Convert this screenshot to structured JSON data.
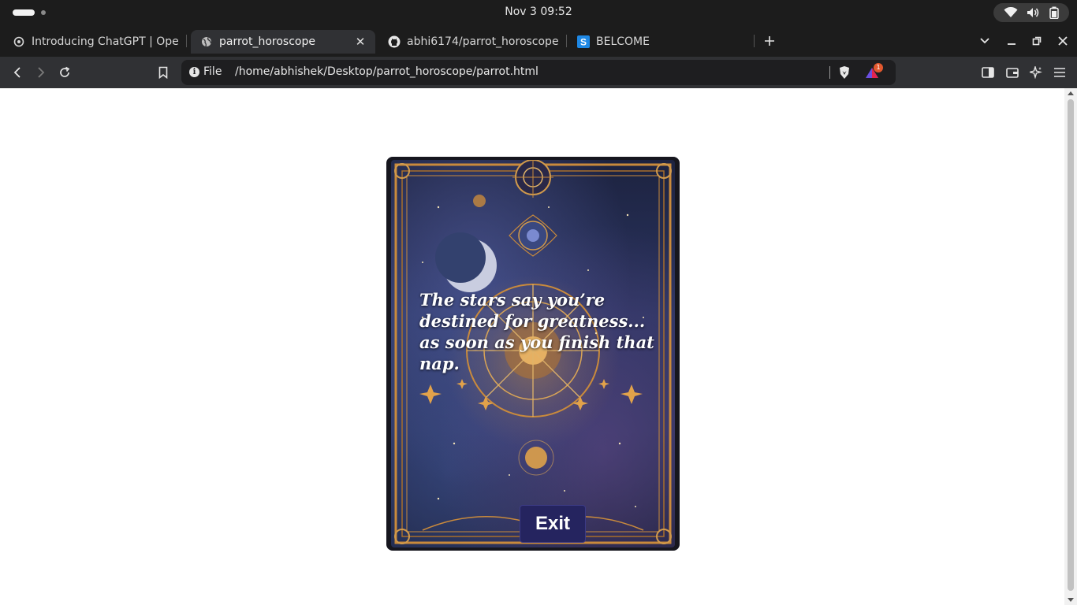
{
  "os": {
    "clock": "Nov 3  09:52",
    "status_icons": [
      "wifi-icon",
      "volume-icon",
      "battery-icon"
    ]
  },
  "tabs": [
    {
      "title": "Introducing ChatGPT | OpenAI",
      "icon": "openai-icon",
      "active": false
    },
    {
      "title": "parrot_horoscope",
      "icon": "globe-icon",
      "active": true
    },
    {
      "title": "abhi6174/parrot_horoscope",
      "icon": "github-icon",
      "active": false
    },
    {
      "title": "BELCOME‎",
      "icon": "s-app-icon",
      "active": false
    }
  ],
  "toolbar": {
    "scheme": "File",
    "url": "/home/abhishek/Desktop/parrot_horoscope/parrot.html",
    "rewards_badge": "1"
  },
  "page": {
    "fortune": "The stars say you’re destined for greatness... as soon as you finish that nap.",
    "exit_label": "Exit"
  },
  "colors": {
    "exit_button": "#25245f",
    "card_frame": "#c98a3c",
    "browser_chrome": "#1c1c1c"
  }
}
